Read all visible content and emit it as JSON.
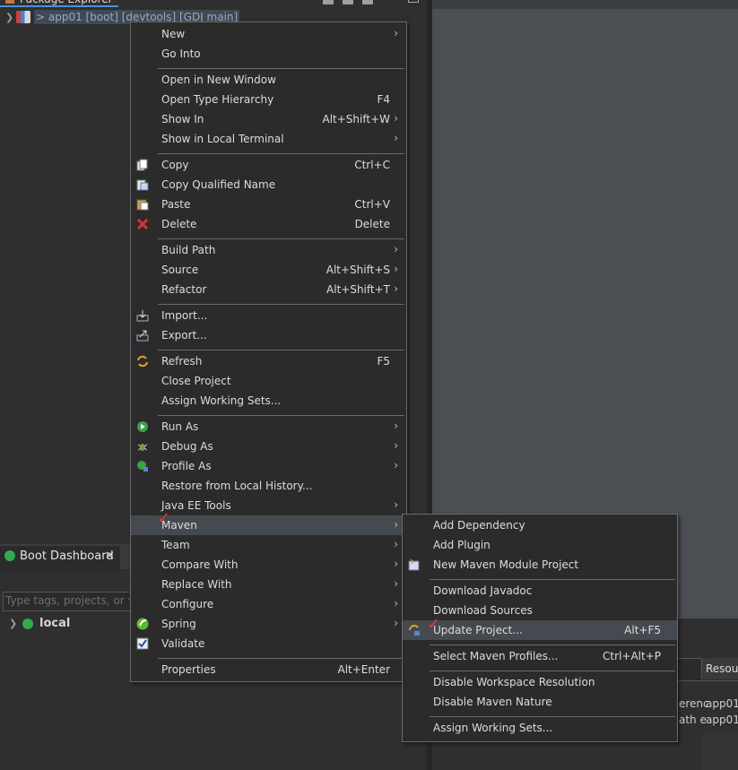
{
  "package_explorer": {
    "tab_title": "Package Explorer",
    "project_label": "> app01 [boot] [devtools] [GDJ main]"
  },
  "context_menu": {
    "items": [
      {
        "label": "New",
        "submenu": true
      },
      {
        "label": "Go Into"
      },
      {
        "label": "Open in New Window"
      },
      {
        "label": "Open Type Hierarchy",
        "shortcut": "F4"
      },
      {
        "label": "Show In",
        "shortcut": "Alt+Shift+W",
        "submenu": true
      },
      {
        "label": "Show in Local Terminal",
        "submenu": true
      },
      {
        "label": "Copy",
        "shortcut": "Ctrl+C",
        "icon": "copy-icon"
      },
      {
        "label": "Copy Qualified Name",
        "icon": "copy-qualified-icon"
      },
      {
        "label": "Paste",
        "shortcut": "Ctrl+V",
        "icon": "paste-icon"
      },
      {
        "label": "Delete",
        "shortcut": "Delete",
        "icon": "delete-icon"
      },
      {
        "label": "Build Path",
        "submenu": true
      },
      {
        "label": "Source",
        "shortcut": "Alt+Shift+S",
        "submenu": true
      },
      {
        "label": "Refactor",
        "shortcut": "Alt+Shift+T",
        "submenu": true
      },
      {
        "label": "Import...",
        "icon": "import-icon"
      },
      {
        "label": "Export...",
        "icon": "export-icon"
      },
      {
        "label": "Refresh",
        "shortcut": "F5",
        "icon": "refresh-icon"
      },
      {
        "label": "Close Project"
      },
      {
        "label": "Assign Working Sets..."
      },
      {
        "label": "Run As",
        "submenu": true,
        "icon": "run-icon"
      },
      {
        "label": "Debug As",
        "submenu": true,
        "icon": "debug-icon"
      },
      {
        "label": "Profile As",
        "submenu": true,
        "icon": "profile-icon"
      },
      {
        "label": "Restore from Local History..."
      },
      {
        "label": "Java EE Tools",
        "submenu": true
      },
      {
        "label": "Maven",
        "submenu": true,
        "highlighted": true
      },
      {
        "label": "Team",
        "submenu": true
      },
      {
        "label": "Compare With",
        "submenu": true
      },
      {
        "label": "Replace With",
        "submenu": true
      },
      {
        "label": "Configure",
        "submenu": true
      },
      {
        "label": "Spring",
        "submenu": true,
        "icon": "spring-icon"
      },
      {
        "label": "Validate",
        "icon": "validate-icon"
      },
      {
        "label": "Properties",
        "shortcut": "Alt+Enter"
      }
    ]
  },
  "maven_submenu": {
    "items": [
      {
        "label": "Add Dependency"
      },
      {
        "label": "Add Plugin"
      },
      {
        "label": "New Maven Module Project",
        "icon": "maven-module-icon"
      },
      {
        "label": "Download Javadoc"
      },
      {
        "label": "Download Sources"
      },
      {
        "label": "Update Project...",
        "shortcut": "Alt+F5",
        "icon": "update-project-icon",
        "highlighted": true
      },
      {
        "label": "Select Maven Profiles...",
        "shortcut": "Ctrl+Alt+P"
      },
      {
        "label": "Disable Workspace Resolution"
      },
      {
        "label": "Disable Maven Nature"
      },
      {
        "label": "Assign Working Sets..."
      }
    ]
  },
  "boot_dashboard": {
    "title": "Boot Dashboard",
    "filter_placeholder": "Type tags, projects, or wo",
    "tree_item": "local"
  },
  "problems_view": {
    "resource_header": "Resour",
    "rows": [
      {
        "desc": "erenc",
        "resource": "app01"
      },
      {
        "desc": "ath e",
        "resource": "app01"
      }
    ]
  },
  "colors": {
    "menu_bg": "#2b2b2b",
    "highlight_bg": "#454a50",
    "annotation_check": "#e03a3a",
    "boot_green": "#36a850"
  }
}
